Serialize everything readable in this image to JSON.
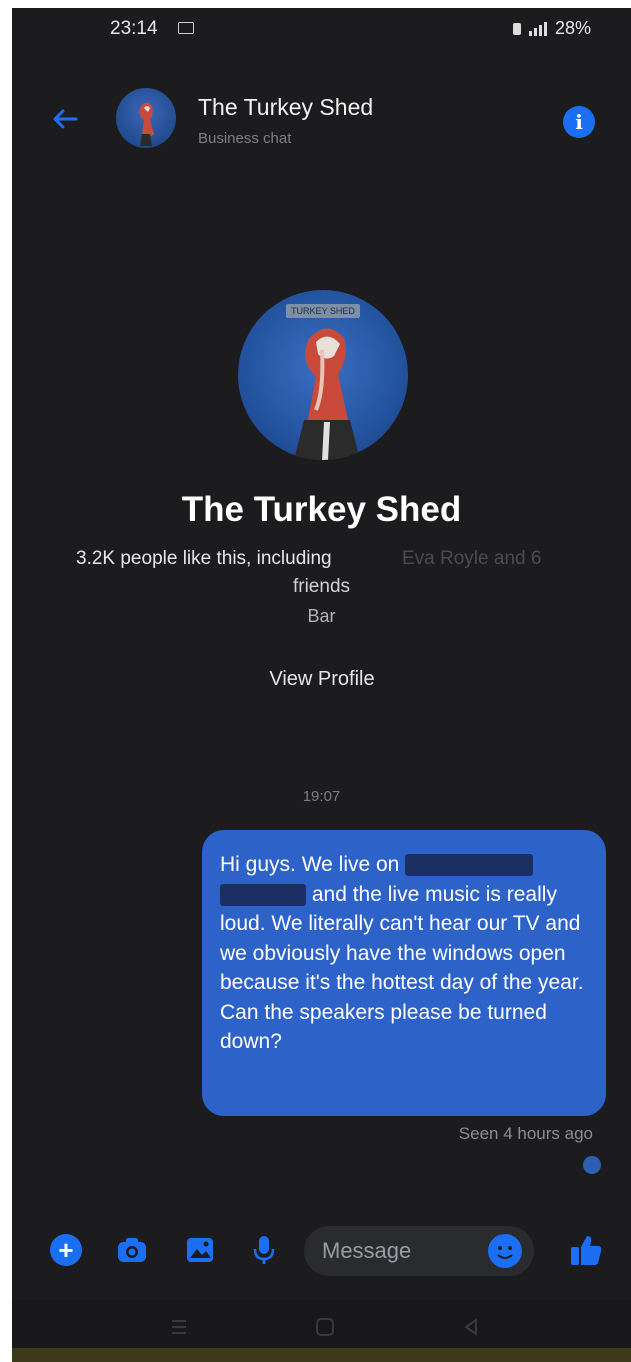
{
  "status_bar": {
    "time": "23:14",
    "battery": "28%"
  },
  "header": {
    "title": "The Turkey Shed",
    "subtitle": "Business chat"
  },
  "profile": {
    "avatar_label": "TURKEY SHED",
    "name": "The Turkey Shed",
    "likes_text": "3.2K people like this, including",
    "likes_friends_blurred": "Eva Royle and 6",
    "likes_text_2": "friends",
    "category": "Bar",
    "view_profile_label": "View Profile"
  },
  "conversation": {
    "timestamp": "19:07",
    "message": {
      "part1": "Hi guys. We live on",
      "part2": "and the live music is really loud. We literally can't hear our TV and we obviously have the windows open because it's the hottest day of the year. Can the speakers please be turned down?",
      "status": "Seen 4 hours ago"
    }
  },
  "composer": {
    "placeholder": "Message"
  },
  "colors": {
    "background": "#1c1c1e",
    "accent": "#1a6ff5",
    "bubble": "#2d63c8"
  },
  "icons": {
    "back": "back-arrow-icon",
    "info": "info-icon",
    "plus": "plus-icon",
    "camera": "camera-icon",
    "gallery": "gallery-icon",
    "mic": "microphone-icon",
    "emoji": "emoji-icon",
    "like": "thumbs-up-icon"
  }
}
